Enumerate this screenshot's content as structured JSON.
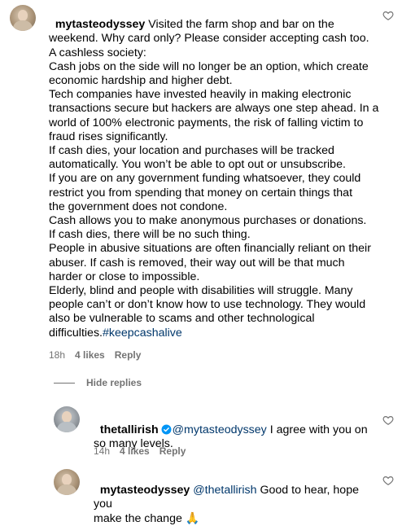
{
  "comments": [
    {
      "username": "mytasteodyssey",
      "lines": [
        " Visited the farm shop and bar on the",
        "weekend. Why card only? Please consider accepting cash too.",
        "A cashless society:",
        "Cash jobs on the side will no longer be an option, which create",
        "economic hardship and higher debt.",
        "Tech companies have invested heavily in making electronic",
        "transactions secure but hackers are always one step ahead. In a",
        "world of 100% electronic payments, the risk of falling victim to",
        "fraud rises significantly.",
        "If cash dies, your location and purchases will be tracked",
        "automatically. You won’t be able to opt out or unsubscribe.",
        "If you are on any government funding whatsoever, they could",
        "restrict you from spending that money on certain things that",
        "the government does not condone.",
        "Cash allows you to make anonymous purchases or donations.",
        "If cash dies, there will be no such thing.",
        "People in abusive situations are often financially reliant on their",
        "abuser. If cash is removed, their way out will be that much",
        "harder or close to impossible.",
        "Elderly, blind and people with disabilities will struggle. Many",
        "people can’t or don’t know how to use technology. They would",
        "also be vulnerable to scams and other technological",
        "difficulties."
      ],
      "hashtag": "#keepcashalive",
      "time": "18h",
      "likes": "4 likes",
      "reply": "Reply"
    },
    {
      "username": "thetallirish",
      "mention": "@mytasteodyssey",
      "text_a": " I agree with you on",
      "text_b": "so many levels.",
      "time": "14h",
      "likes": "4 likes",
      "reply": "Reply"
    },
    {
      "username": "mytasteodyssey",
      "mention": "@thetallirish",
      "text_a": " Good to hear, hope you",
      "text_b": "make the change 🙏"
    }
  ],
  "hide_replies": "Hide replies",
  "icons": {
    "like": "heart-outline-icon",
    "verified": "verified-badge-icon"
  },
  "colors": {
    "link": "#00376b",
    "muted": "#737373",
    "verified": "#0095f6"
  }
}
